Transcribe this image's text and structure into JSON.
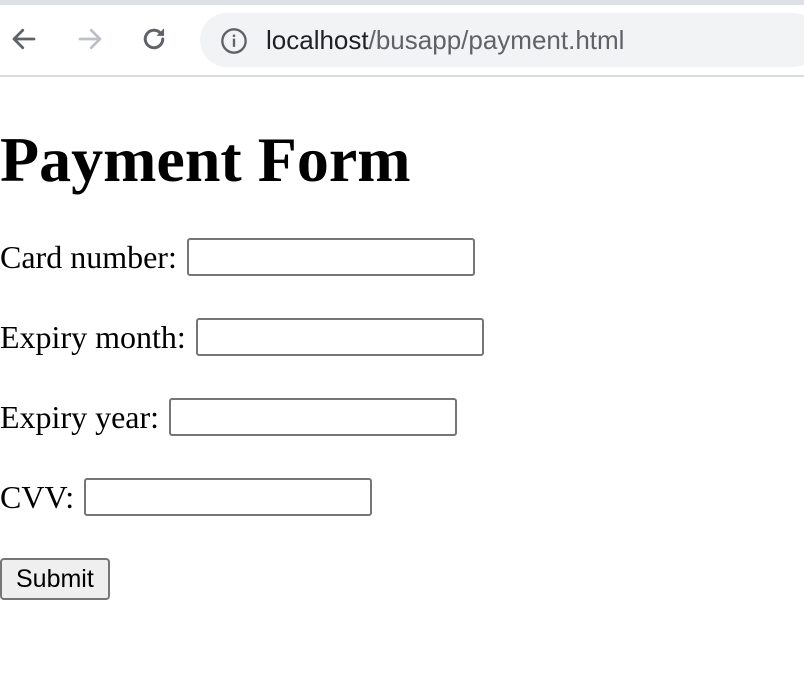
{
  "browser": {
    "url_host": "localhost",
    "url_path": "/busapp/payment.html",
    "icons": {
      "back": "arrow-left-icon",
      "forward": "arrow-right-icon",
      "reload": "reload-icon",
      "info": "info-icon"
    },
    "colors": {
      "toolbar_icon": "#5f6368",
      "disabled_icon": "#bdc1c6",
      "omnibox_bg": "#f1f3f4"
    }
  },
  "page": {
    "title": "Payment Form",
    "fields": [
      {
        "label": "Card number:",
        "value": ""
      },
      {
        "label": "Expiry month:",
        "value": ""
      },
      {
        "label": "Expiry year:",
        "value": ""
      },
      {
        "label": "CVV:",
        "value": ""
      }
    ],
    "submit_label": "Submit"
  }
}
